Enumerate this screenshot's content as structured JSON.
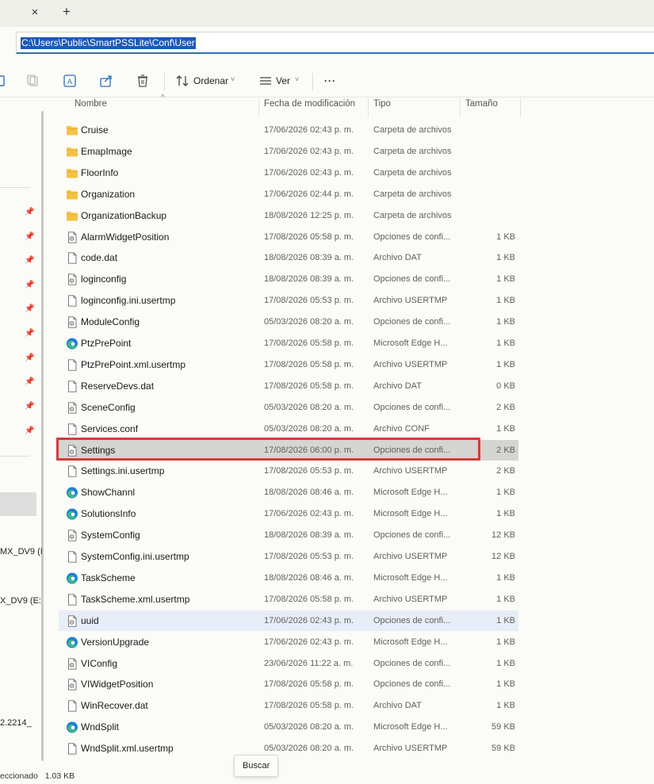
{
  "tabbar": {
    "close_glyph": "×",
    "add_glyph": "+"
  },
  "address": {
    "path": "C:\\Users\\Public\\SmartPSSLite\\Conf\\User"
  },
  "toolbar": {
    "sort_label": "Ordenar",
    "view_label": "Ver",
    "more_label": "···"
  },
  "columns": {
    "name": "Nombre",
    "modified": "Fecha de modificación",
    "type": "Tipo",
    "size": "Tamaño"
  },
  "nav": {
    "drive1": "MX_DV9 (I",
    "drive2": "X_DV9 (E:",
    "net": "2.2214_"
  },
  "files": [
    {
      "name": "Cruise",
      "date": "17/06/2026 02:43 p. m.",
      "type": "Carpeta de archivos",
      "size": "",
      "icon": "folder-icon"
    },
    {
      "name": "EmapImage",
      "date": "17/06/2026 02:43 p. m.",
      "type": "Carpeta de archivos",
      "size": "",
      "icon": "folder-icon"
    },
    {
      "name": "FloorInfo",
      "date": "17/06/2026 02:43 p. m.",
      "type": "Carpeta de archivos",
      "size": "",
      "icon": "folder-icon"
    },
    {
      "name": "Organization",
      "date": "17/06/2026 02:44 p. m.",
      "type": "Carpeta de archivos",
      "size": "",
      "icon": "folder-icon"
    },
    {
      "name": "OrganizationBackup",
      "date": "18/08/2026 12:25 p. m.",
      "type": "Carpeta de archivos",
      "size": "",
      "icon": "folder-icon"
    },
    {
      "name": "AlarmWidgetPosition",
      "date": "17/08/2026 05:58 p. m.",
      "type": "Opciones de confi...",
      "size": "1 KB",
      "icon": "config-file-icon"
    },
    {
      "name": "code.dat",
      "date": "18/08/2026 08:39 a. m.",
      "type": "Archivo DAT",
      "size": "1 KB",
      "icon": "file-icon"
    },
    {
      "name": "loginconfig",
      "date": "18/08/2026 08:39 a. m.",
      "type": "Opciones de confi...",
      "size": "1 KB",
      "icon": "config-file-icon"
    },
    {
      "name": "loginconfig.ini.usertmp",
      "date": "17/08/2026 05:53 p. m.",
      "type": "Archivo USERTMP",
      "size": "1 KB",
      "icon": "file-icon"
    },
    {
      "name": "ModuleConfig",
      "date": "05/03/2026 08:20 a. m.",
      "type": "Opciones de confi...",
      "size": "1 KB",
      "icon": "config-file-icon"
    },
    {
      "name": "PtzPrePoint",
      "date": "17/08/2026 05:58 p. m.",
      "type": "Microsoft Edge H...",
      "size": "1 KB",
      "icon": "edge-icon"
    },
    {
      "name": "PtzPrePoint.xml.usertmp",
      "date": "17/08/2026 05:58 p. m.",
      "type": "Archivo USERTMP",
      "size": "1 KB",
      "icon": "file-icon"
    },
    {
      "name": "ReserveDevs.dat",
      "date": "17/08/2026 05:58 p. m.",
      "type": "Archivo DAT",
      "size": "0 KB",
      "icon": "file-icon"
    },
    {
      "name": "SceneConfig",
      "date": "05/03/2026 08:20 a. m.",
      "type": "Opciones de confi...",
      "size": "2 KB",
      "icon": "config-file-icon"
    },
    {
      "name": "Services.conf",
      "date": "05/03/2026 08:20 a. m.",
      "type": "Archivo CONF",
      "size": "1 KB",
      "icon": "file-icon"
    },
    {
      "name": "Settings",
      "date": "17/08/2026 06:00 p. m.",
      "type": "Opciones de confi...",
      "size": "2 KB",
      "icon": "config-file-icon"
    },
    {
      "name": "Settings.ini.usertmp",
      "date": "17/08/2026 05:53 p. m.",
      "type": "Archivo USERTMP",
      "size": "2 KB",
      "icon": "file-icon"
    },
    {
      "name": "ShowChannl",
      "date": "18/08/2026 08:46 a. m.",
      "type": "Microsoft Edge H...",
      "size": "1 KB",
      "icon": "edge-icon"
    },
    {
      "name": "SolutionsInfo",
      "date": "17/06/2026 02:43 p. m.",
      "type": "Microsoft Edge H...",
      "size": "1 KB",
      "icon": "edge-icon"
    },
    {
      "name": "SystemConfig",
      "date": "18/08/2026 08:39 a. m.",
      "type": "Opciones de confi...",
      "size": "12 KB",
      "icon": "config-file-icon"
    },
    {
      "name": "SystemConfig.ini.usertmp",
      "date": "17/08/2026 05:53 p. m.",
      "type": "Archivo USERTMP",
      "size": "12 KB",
      "icon": "file-icon"
    },
    {
      "name": "TaskScheme",
      "date": "18/08/2026 08:46 a. m.",
      "type": "Microsoft Edge H...",
      "size": "1 KB",
      "icon": "edge-icon"
    },
    {
      "name": "TaskScheme.xml.usertmp",
      "date": "17/08/2026 05:58 p. m.",
      "type": "Archivo USERTMP",
      "size": "1 KB",
      "icon": "file-icon"
    },
    {
      "name": "uuid",
      "date": "17/06/2026 02:43 p. m.",
      "type": "Opciones de confi...",
      "size": "1 KB",
      "icon": "config-file-icon"
    },
    {
      "name": "VersionUpgrade",
      "date": "17/06/2026 02:43 p. m.",
      "type": "Microsoft Edge H...",
      "size": "1 KB",
      "icon": "edge-icon"
    },
    {
      "name": "VIConfig",
      "date": "23/06/2026 11:22 a. m.",
      "type": "Opciones de confi...",
      "size": "1 KB",
      "icon": "config-file-icon"
    },
    {
      "name": "VIWidgetPosition",
      "date": "17/08/2026 05:58 p. m.",
      "type": "Opciones de confi...",
      "size": "1 KB",
      "icon": "config-file-icon"
    },
    {
      "name": "WinRecover.dat",
      "date": "17/08/2026 05:58 p. m.",
      "type": "Archivo DAT",
      "size": "1 KB",
      "icon": "file-icon"
    },
    {
      "name": "WndSplit",
      "date": "05/03/2026 08:20 a. m.",
      "type": "Microsoft Edge H...",
      "size": "59 KB",
      "icon": "edge-icon"
    },
    {
      "name": "WndSplit.xml.usertmp",
      "date": "05/03/2026 08:20 a. m.",
      "type": "Archivo USERTMP",
      "size": "59 KB",
      "icon": "file-icon"
    }
  ],
  "selected_index": 15,
  "hover_index": 23,
  "status": {
    "selected_text": "eccionado",
    "selected_size": "1.03 KB"
  },
  "tooltip": {
    "label": "Buscar"
  },
  "colors": {
    "folder": "#f5c242",
    "edge_blue": "#1f7fd6",
    "edge_green": "#3fc46f",
    "highlight_border": "#d63a3a",
    "address_sel": "#1b5ab8"
  }
}
